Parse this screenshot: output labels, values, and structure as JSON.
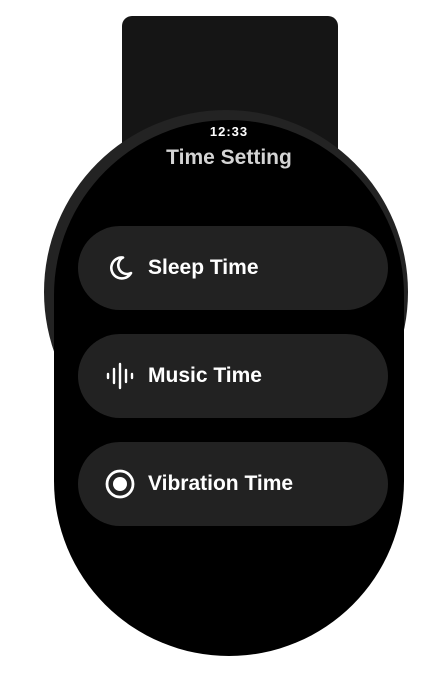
{
  "status_bar": {
    "time": "12:33"
  },
  "header": {
    "title": "Time Setting"
  },
  "menu": {
    "items": [
      {
        "label": "Sleep Time",
        "icon": "moon-icon"
      },
      {
        "label": "Music Time",
        "icon": "sound-wave-icon"
      },
      {
        "label": "Vibration Time",
        "icon": "vibration-icon"
      }
    ]
  },
  "colors": {
    "background": "#000000",
    "chip": "#222222",
    "text": "#ffffff",
    "title": "#d4d4d4"
  }
}
